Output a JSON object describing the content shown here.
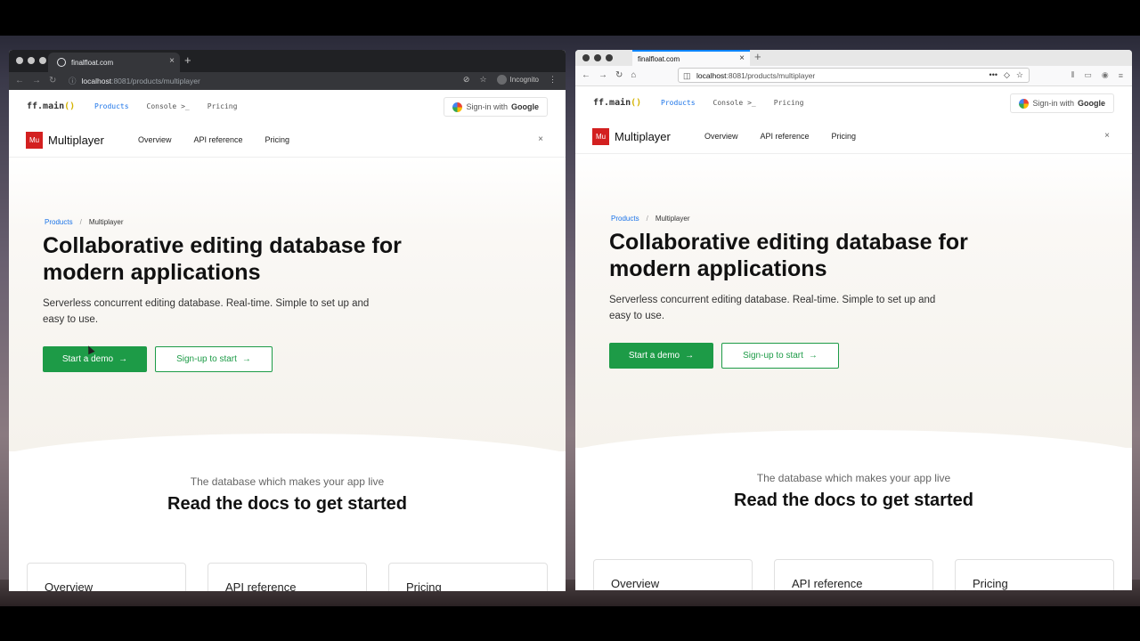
{
  "left_browser": {
    "tab_title": "finalfloat.com",
    "url_host": "localhost",
    "url_rest": ":8081/products/multiplayer",
    "incognito_label": "Incognito"
  },
  "right_browser": {
    "tab_title": "finalfloat.com",
    "url_host": "localhost",
    "url_rest": ":8081/products/multiplayer"
  },
  "site": {
    "logo_text": "ff.main",
    "logo_parens": "()",
    "nav": [
      "Products",
      "Console >_",
      "Pricing"
    ],
    "signin_prefix": "Sign-in with",
    "signin_brand": "Google",
    "product_badge": "Mu",
    "product_name": "Multiplayer",
    "product_links": [
      "Overview",
      "API reference",
      "Pricing"
    ],
    "close_glyph": "×",
    "breadcrumb": [
      "Products",
      "/",
      "Multiplayer"
    ],
    "headline": "Collaborative editing database for modern applications",
    "subhead": "Serverless concurrent editing database. Real-time. Simple to set up and easy to use.",
    "cta_primary": "Start a demo",
    "cta_secondary": "Sign-up to start",
    "arrow": "→",
    "section_kicker": "The database which makes your app live",
    "section_title": "Read the docs to get started",
    "cards": [
      "Overview",
      "API reference",
      "Pricing"
    ]
  },
  "colors": {
    "brand_green": "#1d9b47",
    "link_blue": "#1a73e8",
    "badge_red": "#d32020"
  }
}
